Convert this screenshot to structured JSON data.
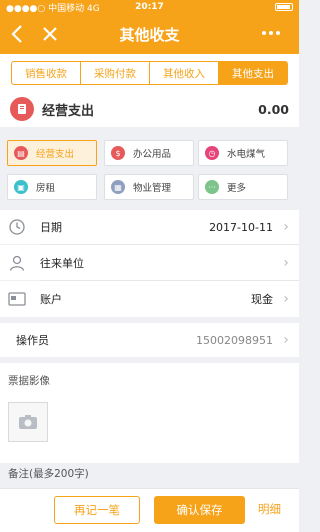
{
  "status_bar": {
    "carrier": "中国移动",
    "network": "4G",
    "time": "20:17",
    "battery_level": 0.9
  },
  "header": {
    "title": "其他收支",
    "back_icon": "chevron-left-icon",
    "close_icon": "close-icon",
    "more_icon": "more-dots-icon"
  },
  "tabs": [
    {
      "label": "销售收款",
      "active": false
    },
    {
      "label": "采购付款",
      "active": false
    },
    {
      "label": "其他收入",
      "active": false
    },
    {
      "label": "其他支出",
      "active": true
    }
  ],
  "entry": {
    "type_label": "经营支出",
    "amount": "0.00"
  },
  "categories": [
    {
      "label": "经营支出",
      "icon": "expense-icon",
      "color": "#e65a5a",
      "selected": true
    },
    {
      "label": "办公用品",
      "icon": "bag-icon",
      "color": "#e65a5a",
      "selected": false
    },
    {
      "label": "水电煤气",
      "icon": "clock-icon",
      "color": "#e6457a",
      "selected": false
    },
    {
      "label": "房租",
      "icon": "car-icon",
      "color": "#3cc0c9",
      "selected": false
    },
    {
      "label": "物业管理",
      "icon": "cart-icon",
      "color": "#8f9fbf",
      "selected": false
    },
    {
      "label": "更多",
      "icon": "more-icon",
      "color": "#7cc48a",
      "selected": false
    }
  ],
  "form": {
    "date_label": "日期",
    "date_value": "2017-10-11",
    "partner_label": "往来单位",
    "partner_value": "",
    "account_label": "账户",
    "account_value": "现金",
    "operator_label": "操作员",
    "operator_value": "15002098951",
    "photos_label": "票据影像",
    "remark_label": "备注(最多200字)"
  },
  "footer": {
    "again_label": "再记一笔",
    "save_label": "确认保存",
    "detail_label": "明细"
  },
  "colors": {
    "accent": "#f6a31a",
    "danger": "#e65a5a"
  }
}
